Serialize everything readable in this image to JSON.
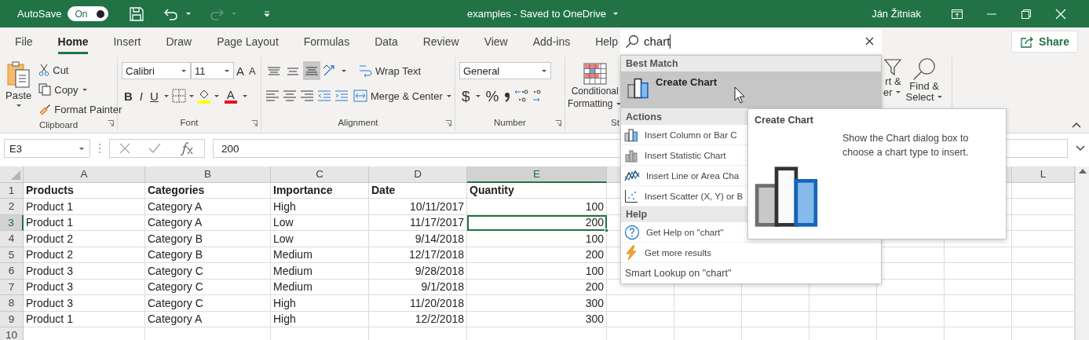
{
  "title_bar": {
    "autosave": {
      "label": "AutoSave",
      "on": true,
      "state_label": "On"
    },
    "redo_disabled": true,
    "document_title": "examples  -  Saved to OneDrive",
    "user": "Ján Žitniak"
  },
  "tabs": [
    {
      "label": "File",
      "selected": false
    },
    {
      "label": "Home",
      "selected": true
    },
    {
      "label": "Insert",
      "selected": false
    },
    {
      "label": "Draw",
      "selected": false
    },
    {
      "label": "Page Layout",
      "selected": false
    },
    {
      "label": "Formulas",
      "selected": false
    },
    {
      "label": "Data",
      "selected": false
    },
    {
      "label": "Review",
      "selected": false
    },
    {
      "label": "View",
      "selected": false
    },
    {
      "label": "Add-ins",
      "selected": false
    },
    {
      "label": "Help",
      "selected": false
    }
  ],
  "search": {
    "value": "chart"
  },
  "share": {
    "label": "Share"
  },
  "ribbon": {
    "clipboard": {
      "label": "Clipboard",
      "paste": "Paste",
      "cut": "Cut",
      "copy": "Copy",
      "format_painter": "Format Painter"
    },
    "font": {
      "label": "Font",
      "font_name": "Calibri",
      "font_size": "11",
      "grow": "A",
      "shrink": "A",
      "bold": "B",
      "italic": "I",
      "underline": "U",
      "font_color": "A"
    },
    "alignment": {
      "label": "Alignment",
      "vertical": [
        {
          "kind": "top",
          "selected": false
        },
        {
          "kind": "middle",
          "selected": false
        },
        {
          "kind": "bottom",
          "selected": true
        }
      ],
      "wrap_text": "Wrap Text",
      "merge_center": "Merge & Center"
    },
    "number": {
      "label": "Number",
      "format": "General",
      "currency": "$",
      "percent": "%"
    },
    "styles": {
      "label": "St",
      "conditional_formatting": [
        "Conditional",
        "Formatting"
      ]
    },
    "editing": {
      "sort_filter": [
        "rt &",
        "er"
      ],
      "find_select": [
        "Find &",
        "Select"
      ]
    }
  },
  "formula_bar": {
    "name_box": "E3",
    "value": "200"
  },
  "sheet": {
    "columns": [
      {
        "label": "A",
        "selected": false
      },
      {
        "label": "B",
        "selected": false
      },
      {
        "label": "C",
        "selected": false
      },
      {
        "label": "D",
        "selected": false
      },
      {
        "label": "E",
        "selected": true
      },
      {
        "selected": false
      },
      {},
      {},
      {},
      {},
      {
        "selected": false
      },
      {
        "label": "L",
        "selected": false
      }
    ],
    "rows": [
      {
        "number": "1",
        "kind": "header",
        "selected": false,
        "cells": [
          "Products",
          "Categories",
          "Importance",
          "Date",
          "Quantity"
        ]
      },
      {
        "number": "2",
        "kind": "data",
        "selected": false,
        "cells": [
          "Product 1",
          "Category A",
          "High",
          "10/11/2017",
          "100"
        ]
      },
      {
        "number": "3",
        "kind": "data",
        "selected": true,
        "cells": [
          "Product 1",
          "Category A",
          "Low",
          "11/17/2017",
          "200"
        ]
      },
      {
        "number": "4",
        "kind": "data",
        "selected": false,
        "cells": [
          "Product 2",
          "Category B",
          "Low",
          "9/14/2018",
          "100"
        ]
      },
      {
        "number": "5",
        "kind": "data",
        "selected": false,
        "cells": [
          "Product 2",
          "Category B",
          "Medium",
          "12/17/2018",
          "200"
        ]
      },
      {
        "number": "6",
        "kind": "data",
        "selected": false,
        "cells": [
          "Product 3",
          "Category C",
          "Medium",
          "9/28/2018",
          "100"
        ]
      },
      {
        "number": "7",
        "kind": "data",
        "selected": false,
        "cells": [
          "Product 3",
          "Category C",
          "Medium",
          "9/1/2018",
          "200"
        ]
      },
      {
        "number": "8",
        "kind": "data",
        "selected": false,
        "cells": [
          "Product 3",
          "Category C",
          "High",
          "11/20/2018",
          "300"
        ]
      },
      {
        "number": "9",
        "kind": "data",
        "selected": false,
        "cells": [
          "Product 1",
          "Category A",
          "High",
          "12/2/2018",
          "300"
        ]
      },
      {
        "number": "10",
        "kind": "data",
        "selected": false
      }
    ]
  },
  "search_results": {
    "sections": [
      {
        "title": "Best Match",
        "items": [
          {
            "kind": "create_chart",
            "label": "Create Chart",
            "selected": true
          }
        ]
      },
      {
        "title": "Actions",
        "items": [
          {
            "kind": "column_chart",
            "label": "Insert Column or Bar C",
            "selected": false
          },
          {
            "kind": "statistic_chart",
            "label": "Insert Statistic Chart",
            "selected": false
          },
          {
            "kind": "line_chart",
            "label": "Insert Line or Area Cha",
            "selected": false
          },
          {
            "kind": "scatter_chart",
            "label": "Insert Scatter (X, Y) or B",
            "selected": false
          }
        ]
      },
      {
        "title": "Help",
        "items": [
          {
            "kind": "help",
            "label": "Get Help on \"chart\"",
            "selected": false
          },
          {
            "kind": "more",
            "label": "Get more results",
            "selected": false
          }
        ]
      }
    ],
    "footer": "Smart Lookup on \"chart\""
  },
  "tooltip": {
    "title": "Create Chart",
    "description": "Show the Chart dialog box to choose a chart type to insert."
  }
}
